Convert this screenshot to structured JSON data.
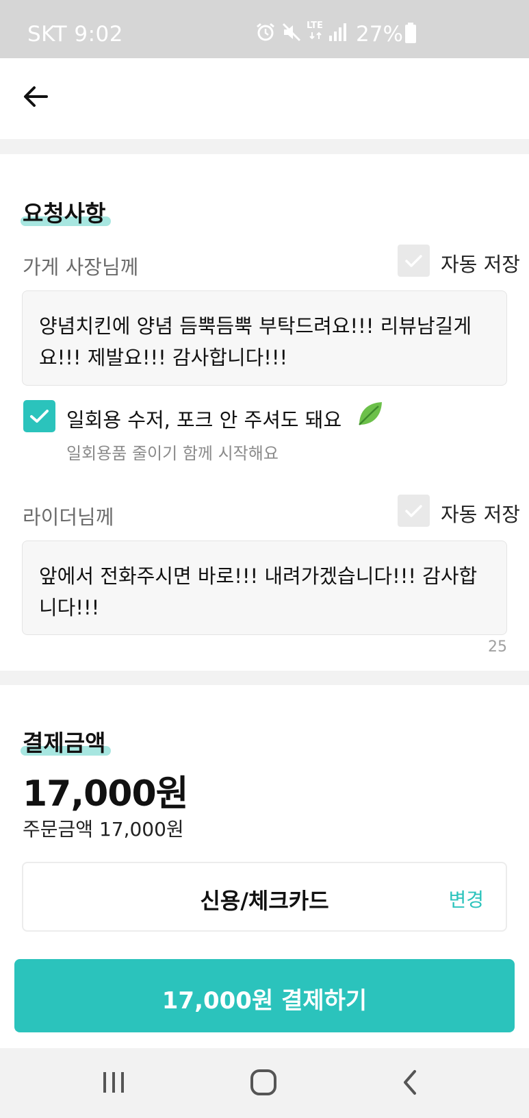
{
  "status_bar": {
    "carrier_time": "SKT 9:02",
    "network": "LTE",
    "battery": "27%",
    "icons": [
      "alarm-icon",
      "mute-icon",
      "lte-icon",
      "signal-icon",
      "battery-icon"
    ]
  },
  "header": {
    "back_icon": "arrow-left-icon"
  },
  "request": {
    "title": "요청사항",
    "store": {
      "label": "가게 사장님께",
      "auto_save_label": "자동 저장",
      "auto_save_checked": false,
      "text": "양념치킨에 양념 듬뿍듬뿍 부탁드려요!!! 리뷰남길게요!!! 제발요!!! 감사합니다!!!"
    },
    "utensils": {
      "checked": true,
      "label": "일회용 수저, 포크 안 주셔도 돼요",
      "sub_label": "일회용품 줄이기 함께 시작해요",
      "icon": "leaf-icon"
    },
    "rider": {
      "label": "라이더님께",
      "auto_save_label": "자동 저장",
      "auto_save_checked": false,
      "text": "앞에서 전화주시면 바로!!! 내려가겠습니다!!! 감사합니다!!!",
      "char_count": "25"
    }
  },
  "payment": {
    "title": "결제금액",
    "total": "17,000원",
    "order_amount": "주문금액 17,000원",
    "method": "신용/체크카드",
    "change_label": "변경",
    "pay_button_label": "17,000원 결제하기"
  },
  "colors": {
    "accent": "#2bc3bc",
    "highlight": "#a7e6e0",
    "status_bar": "#d6d6d6",
    "section_gap": "#f2f2f2"
  },
  "nav": {
    "icons": [
      "recent-apps-icon",
      "home-icon",
      "back-icon"
    ]
  }
}
